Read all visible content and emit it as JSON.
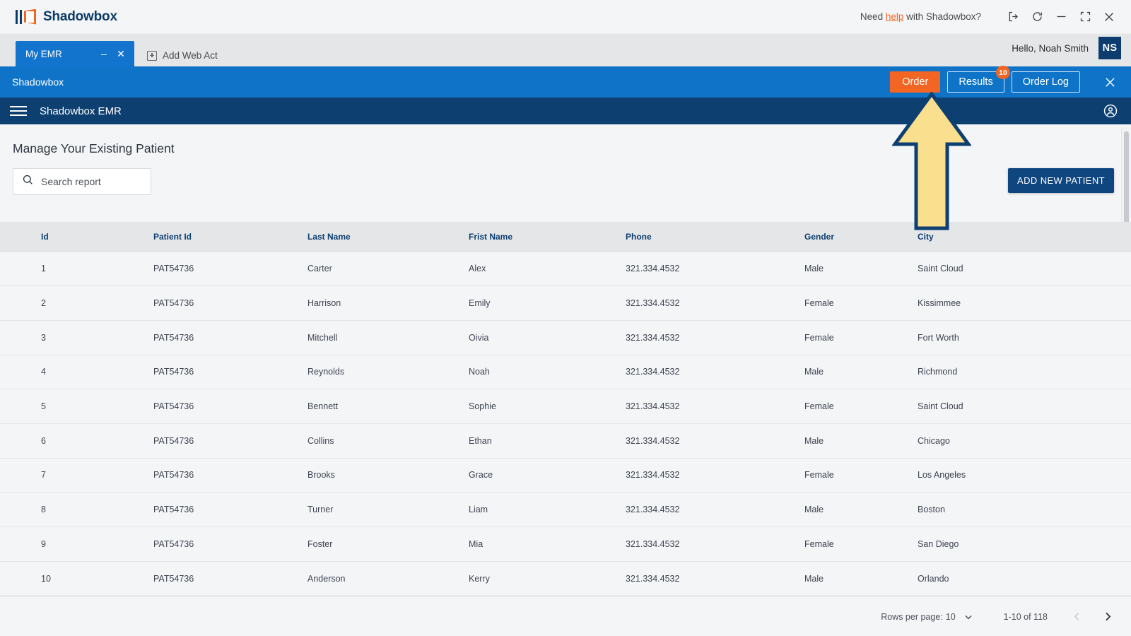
{
  "titlebar": {
    "brand_name": "Shadowbox",
    "help_prefix": "Need ",
    "help_link": "help",
    "help_suffix": " with Shadowbox?",
    "icons": [
      "logout-icon",
      "refresh-icon",
      "minimize-icon",
      "restore-icon",
      "close-icon"
    ]
  },
  "tabstrip": {
    "tab_label": "My EMR",
    "tab_minimize": "–",
    "tab_close": "✕",
    "add_tab_label": "Add Web Act",
    "hello_text": "Hello, Noah Smith",
    "avatar_initials": "NS"
  },
  "appbar": {
    "title": "Shadowbox",
    "order_label": "Order",
    "results_label": "Results",
    "results_badge": "10",
    "order_log_label": "Order Log",
    "close_label": "✕",
    "accent_orange": "#f26522",
    "bar_blue": "#0f74c8"
  },
  "emrbar": {
    "title": "Shadowbox EMR",
    "bar_navy": "#0d3f70"
  },
  "main": {
    "page_title": "Manage Your Existing Patient",
    "search_placeholder": "Search report",
    "search_value": "",
    "add_patient_label": "ADD NEW PATIENT",
    "add_patient_color": "#10467f"
  },
  "table": {
    "columns": [
      "Id",
      "Patient Id",
      "Last Name",
      "Frist Name",
      "Phone",
      "Gender",
      "City"
    ],
    "rows": [
      {
        "id": "1",
        "patient_id": "PAT54736",
        "last_name": "Carter",
        "first_name": "Alex",
        "phone": "321.334.4532",
        "gender": "Male",
        "city": "Saint Cloud"
      },
      {
        "id": "2",
        "patient_id": "PAT54736",
        "last_name": "Harrison",
        "first_name": "Emily",
        "phone": "321.334.4532",
        "gender": "Female",
        "city": "Kissimmee"
      },
      {
        "id": "3",
        "patient_id": "PAT54736",
        "last_name": "Mitchell",
        "first_name": "Oivia",
        "phone": "321.334.4532",
        "gender": "Female",
        "city": "Fort Worth"
      },
      {
        "id": "4",
        "patient_id": "PAT54736",
        "last_name": "Reynolds",
        "first_name": "Noah",
        "phone": "321.334.4532",
        "gender": "Male",
        "city": "Richmond"
      },
      {
        "id": "5",
        "patient_id": "PAT54736",
        "last_name": "Bennett",
        "first_name": "Sophie",
        "phone": "321.334.4532",
        "gender": "Female",
        "city": "Saint Cloud"
      },
      {
        "id": "6",
        "patient_id": "PAT54736",
        "last_name": "Collins",
        "first_name": "Ethan",
        "phone": "321.334.4532",
        "gender": "Male",
        "city": "Chicago"
      },
      {
        "id": "7",
        "patient_id": "PAT54736",
        "last_name": "Brooks",
        "first_name": "Grace",
        "phone": "321.334.4532",
        "gender": "Female",
        "city": "Los Angeles"
      },
      {
        "id": "8",
        "patient_id": "PAT54736",
        "last_name": "Turner",
        "first_name": "Liam",
        "phone": "321.334.4532",
        "gender": "Male",
        "city": "Boston"
      },
      {
        "id": "9",
        "patient_id": "PAT54736",
        "last_name": "Foster",
        "first_name": "Mia",
        "phone": "321.334.4532",
        "gender": "Female",
        "city": "San Diego"
      },
      {
        "id": "10",
        "patient_id": "PAT54736",
        "last_name": "Anderson",
        "first_name": "Kerry",
        "phone": "321.334.4532",
        "gender": "Male",
        "city": "Orlando"
      }
    ]
  },
  "pagination": {
    "rows_per_page_label": "Rows per page:",
    "rows_per_page_value": "10",
    "range_label": "1-10 of 118"
  },
  "annotation": {
    "type": "up-arrow",
    "points_to": "Order",
    "fill": "#fadf8f",
    "stroke": "#0d3f70"
  }
}
